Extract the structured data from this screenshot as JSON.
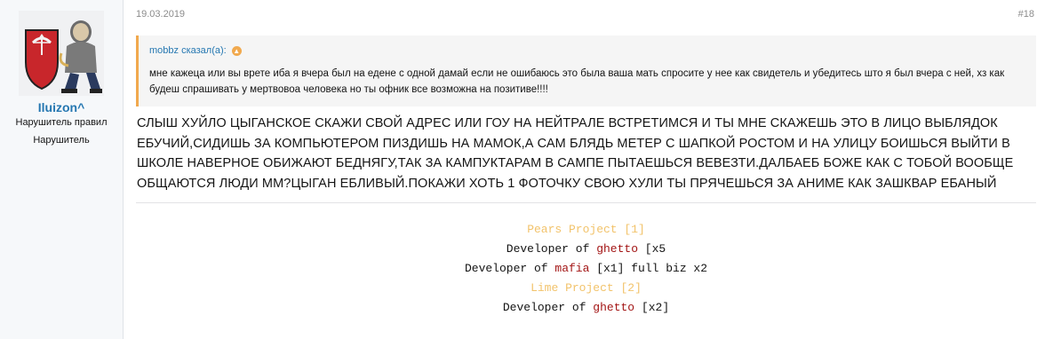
{
  "user": {
    "username": "Iluizon^",
    "title_1": "Нарушитель правил",
    "title_2": "Нарушитель"
  },
  "post": {
    "date": "19.03.2019",
    "number": "#18",
    "quote": {
      "author_line": "mobbz сказал(а):",
      "text": "мне кажеца или вы врете иба я вчера был на едене с одной дамай если не ошибаюсь это была ваша мать спросите у нее как свидетель и убедитесь што я был вчера с ней, хз как будеш спрашивать у мертвовоа человека но ты офник все возможна на позитиве!!!!"
    },
    "body": "СЛЫШ ХУЙЛО ЦЫГАНСКОЕ СКАЖИ СВОЙ АДРЕС ИЛИ ГОУ НА НЕЙТРАЛЕ ВСТРЕТИМСЯ И ТЫ МНЕ СКАЖЕШЬ ЭТО В ЛИЦО ВЫБЛЯДОК ЕБУЧИЙ,СИДИШЬ ЗА КОМПЬЮТЕРОМ ПИЗДИШЬ НА МАМОК,А САМ БЛЯДЬ МЕТЕР С ШАПКОЙ РОСТОМ И НА УЛИЦУ БОИШЬСЯ ВЫЙТИ В ШКОЛЕ НАВЕРНОЕ ОБИЖАЮТ БЕДНЯГУ,ТАК ЗА КАМПУКТАРАМ В САМПЕ ПЫТАЕШЬСЯ ВЕВЕЗТИ.ДАЛБАЕБ БОЖЕ КАК С ТОБОЙ ВООБЩЕ ОБЩАЮТСЯ ЛЮДИ ММ?ЦЫГАН ЕБЛИВЫЙ.ПОКАЖИ ХОТЬ 1 ФОТОЧКУ СВОЮ ХУЛИ ТЫ ПРЯЧЕШЬСЯ ЗА АНИМЕ КАК ЗАШКВАР ЕБАНЫЙ"
  },
  "signature": {
    "line1": "Pears Project [1]",
    "line2_prefix": "Developer of ",
    "line2_word": "ghetto",
    "line2_suffix": " [x5",
    "line3_prefix": "Developer of ",
    "line3_word": "mafia",
    "line3_suffix": " [x1] full biz x2",
    "line4": "Lime Project [2]",
    "line5_prefix": "Developer of ",
    "line5_word": "ghetto",
    "line5_suffix": " [x2]"
  },
  "icons": {
    "quote_expand": "arrow-up-circle-icon",
    "avatar": "avatar-image"
  },
  "colors": {
    "username": "#2577b1",
    "quote_bar": "#f1a94e",
    "signature_gold": "#f2c36b",
    "signature_red": "#a31515"
  }
}
